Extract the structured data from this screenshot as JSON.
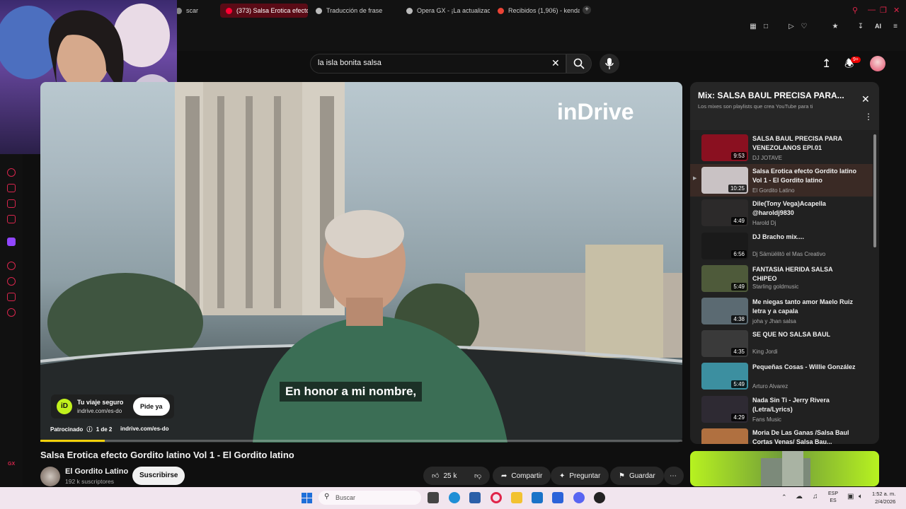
{
  "browser": {
    "tabs": [
      {
        "label": "scar",
        "color": "#888888"
      },
      {
        "label": "(373) Salsa Erotica efecto",
        "color": "#ff0033",
        "active": true
      },
      {
        "label": "Traducción de frase",
        "color": "#bbbbbb"
      },
      {
        "label": "Opera GX - ¡La actualizac",
        "color": "#bbbbbb"
      },
      {
        "label": "Recibidos (1,906) - kendal",
        "color": "#ea4335"
      }
    ],
    "new_tab_label": "+",
    "ai_label": "AI",
    "sidebar_label": "GX"
  },
  "youtube": {
    "search_value": "la isla bonita salsa",
    "notification_count": "9+"
  },
  "ad": {
    "brand_watermark": "inDrive",
    "subtitle": "En honor a mi nombre,",
    "card_title": "Tu viaje seguro",
    "card_url": "indrive.com/es-do",
    "cta": "Pide ya",
    "sponsored": "Patrocinado",
    "ad_count": "1 de 2",
    "footer_url": "indrive.com/es-do",
    "progress_fraction": 0.1
  },
  "playlist": {
    "title": "Mix: SALSA BAUL PRECISA PARA...",
    "subtitle": "Los mixes son playlists que crea YouTube para ti",
    "items": [
      {
        "title": "SALSA BAUL PRECISA PARA VENEZOLANOS EPI.01",
        "channel": "DJ JOTAVE",
        "duration": "9:53",
        "thumb_color": "#8a1020"
      },
      {
        "title": "Salsa Erotica efecto Gordito latino Vol 1 - El Gordito latino",
        "channel": "El Gordito Latino",
        "duration": "10:25",
        "thumb_color": "#c9c2c4",
        "active": true
      },
      {
        "title": "Dile(Tony Vega)Acapella @haroldj9830",
        "channel": "Harold Dj",
        "duration": "4:49",
        "thumb_color": "#2c2a2a"
      },
      {
        "title": "DJ Bracho mix....",
        "channel": "Dj Sämüëlitö el Mas Creativo",
        "duration": "6:56",
        "thumb_color": "#1a1a1a"
      },
      {
        "title": "FANTASIA HERIDA SALSA CHIPEO",
        "channel": "Starling goldmusic",
        "duration": "5:49",
        "thumb_color": "#4e5a3a"
      },
      {
        "title": "Me niegas tanto amor Maelo Ruiz letra y a capala",
        "channel": "joha y Jhan salsa",
        "duration": "4:38",
        "thumb_color": "#5b6a72"
      },
      {
        "title": "SE QUE NO SALSA BAUL",
        "channel": "King Jordi",
        "duration": "4:35",
        "thumb_color": "#3a3a3a"
      },
      {
        "title": "Pequeñas Cosas - Willie González",
        "channel": "Arturo Alvarez",
        "duration": "5:49",
        "thumb_color": "#3c8fa0"
      },
      {
        "title": "Nada Sin Ti - Jerry Rivera (Letra/Lyrics)",
        "channel": "Fans Music",
        "duration": "4:29",
        "thumb_color": "#2e2a33"
      },
      {
        "title": "Moria De Las Ganas /Salsa Baul Cortas Venas/ Salsa Bau...",
        "channel": "",
        "duration": "",
        "thumb_color": "#b07040"
      }
    ]
  },
  "video": {
    "title": "Salsa Erotica efecto Gordito latino Vol 1 - El Gordito latino",
    "channel": "El Gordito Latino",
    "subscribers": "192 k suscriptores",
    "subscribe_label": "Suscribirse",
    "likes": "25 k",
    "share_label": "Compartir",
    "ask_label": "Preguntar",
    "save_label": "Guardar"
  },
  "taskbar": {
    "search_placeholder": "Buscar",
    "lang_top": "ESP",
    "lang_bottom": "ES",
    "time": "1:52 a. m.",
    "date": "2/4/2026"
  }
}
